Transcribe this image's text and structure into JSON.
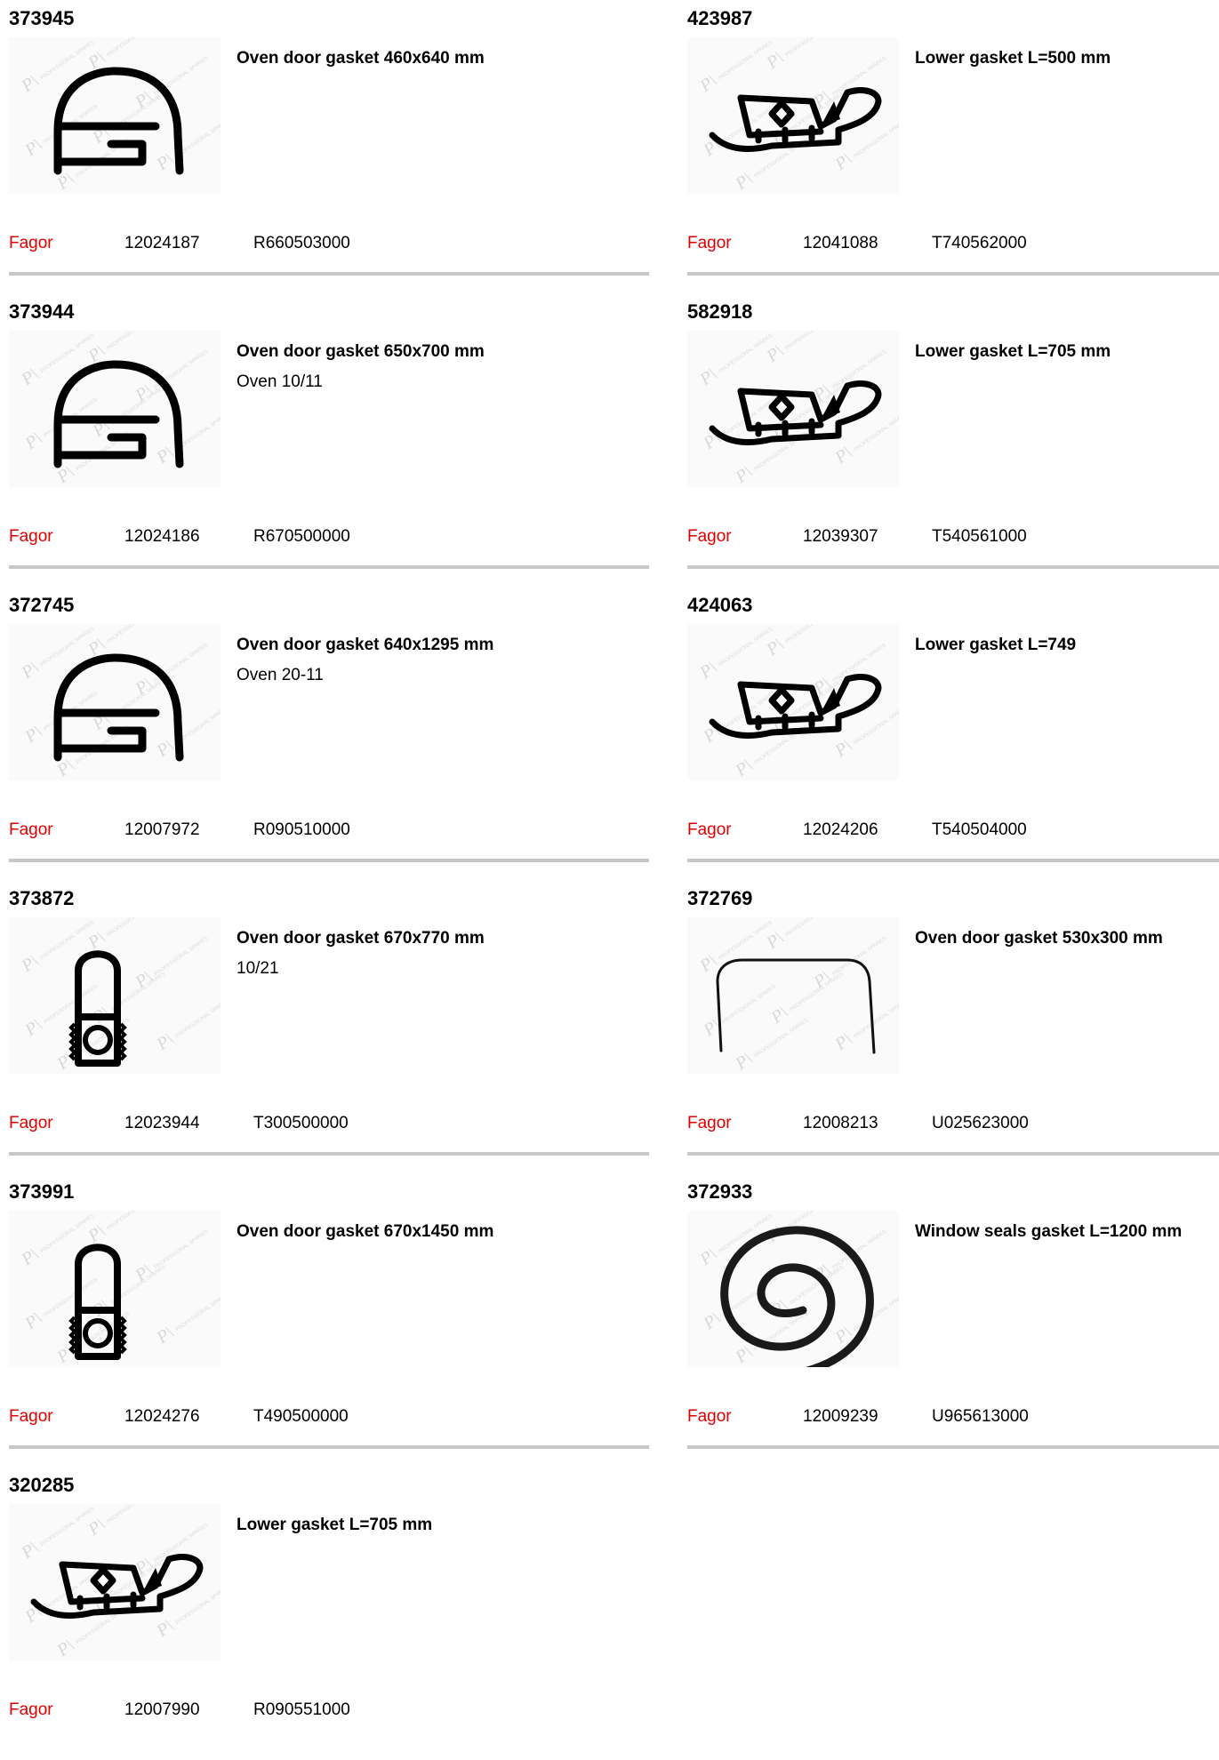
{
  "items": [
    {
      "code": "373945",
      "title": "Oven door gasket 460x640 mm",
      "subtitle": "",
      "brand": "Fagor",
      "ref1": "12024187",
      "ref2": "R660503000",
      "shape": "arch"
    },
    {
      "code": "423987",
      "title": "Lower gasket L=500 mm",
      "subtitle": "",
      "brand": "Fagor",
      "ref1": "12041088",
      "ref2": "T740562000",
      "shape": "lower"
    },
    {
      "code": "373944",
      "title": "Oven door gasket 650x700 mm",
      "subtitle": "Oven 10/11",
      "brand": "Fagor",
      "ref1": "12024186",
      "ref2": "R670500000",
      "shape": "arch"
    },
    {
      "code": "582918",
      "title": "Lower gasket L=705 mm",
      "subtitle": "",
      "brand": "Fagor",
      "ref1": "12039307",
      "ref2": "T540561000",
      "shape": "lower"
    },
    {
      "code": "372745",
      "title": "Oven door gasket 640x1295 mm",
      "subtitle": "Oven 20-11",
      "brand": "Fagor",
      "ref1": "12007972",
      "ref2": "R090510000",
      "shape": "arch"
    },
    {
      "code": "424063",
      "title": "Lower gasket L=749",
      "subtitle": "",
      "brand": "Fagor",
      "ref1": "12024206",
      "ref2": "T540504000",
      "shape": "lower"
    },
    {
      "code": "373872",
      "title": "Oven door gasket 670x770 mm",
      "subtitle": "10/21",
      "brand": "Fagor",
      "ref1": "12023944",
      "ref2": "T300500000",
      "shape": "bulb"
    },
    {
      "code": "372769",
      "title": "Oven door gasket 530x300 mm",
      "subtitle": "",
      "brand": "Fagor",
      "ref1": "12008213",
      "ref2": "U025623000",
      "shape": "frame"
    },
    {
      "code": "373991",
      "title": "Oven door gasket 670x1450 mm",
      "subtitle": "",
      "brand": "Fagor",
      "ref1": "12024276",
      "ref2": "T490500000",
      "shape": "bulb"
    },
    {
      "code": "372933",
      "title": "Window seals gasket L=1200 mm",
      "subtitle": "",
      "brand": "Fagor",
      "ref1": "12009239",
      "ref2": "U965613000",
      "shape": "spiral"
    },
    {
      "code": "320285",
      "title": "Lower gasket L=705 mm",
      "subtitle": "",
      "brand": "Fagor",
      "ref1": "12007990",
      "ref2": "R090551000",
      "shape": "lower"
    }
  ],
  "watermark_text": "PROFESSIONAL SPARES",
  "colors": {
    "brand": "#e00000",
    "separator": "#c8c8c8"
  }
}
